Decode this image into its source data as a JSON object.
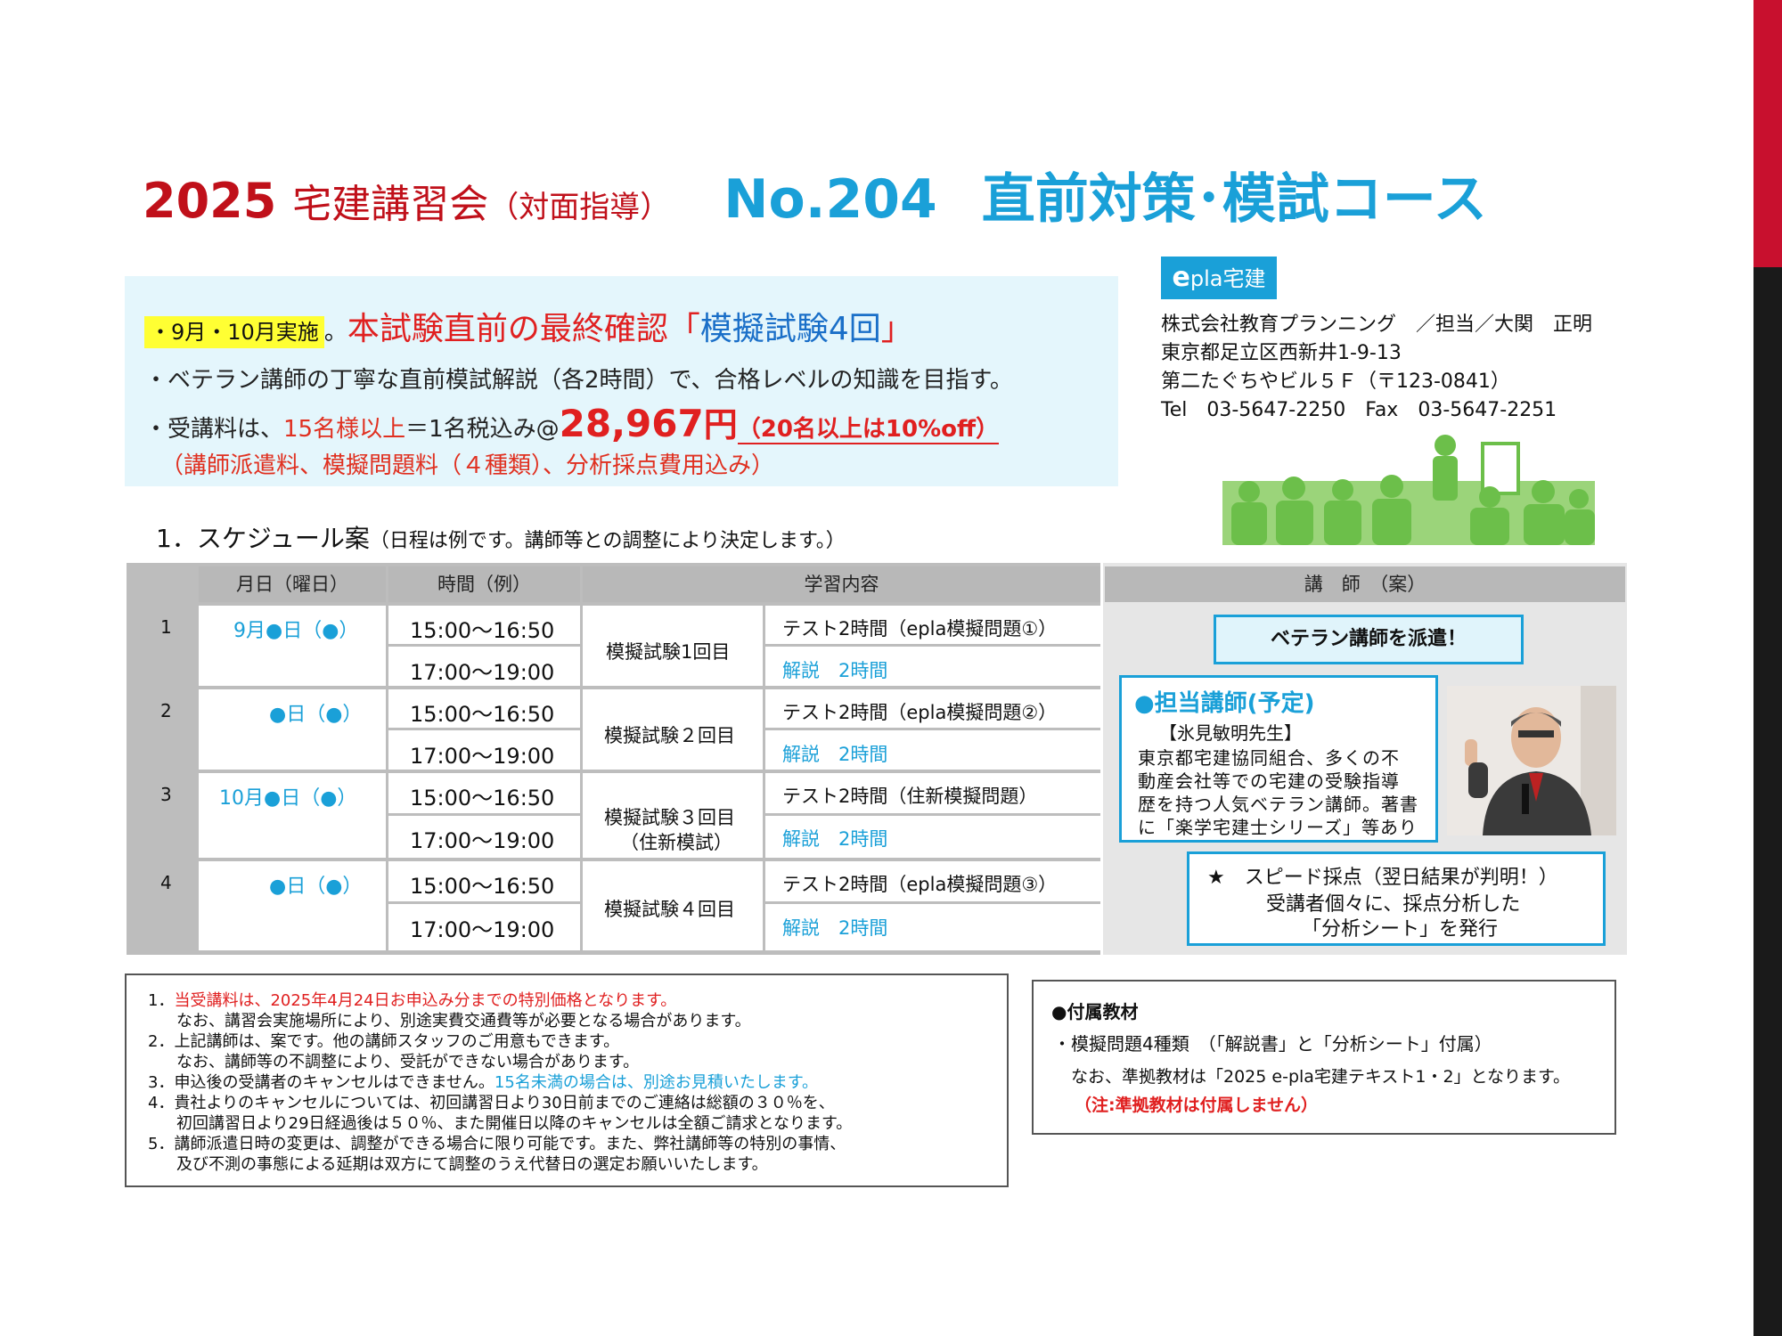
{
  "title": {
    "year": "2025",
    "main": "宅建講習会",
    "paren": "（対面指導）",
    "number": "No.204",
    "course": "直前対策･模試コース"
  },
  "intro": {
    "highlight": "・9月・10月実施",
    "line1_dot": "。",
    "line1_main": "本試験直前の最終確認",
    "line1_open": "「",
    "line1_blue": "模擬試験4回",
    "line1_close": "」",
    "line2": "・ベテラン講師の丁寧な直前模試解説（各2時間）で、合格レベルの知識を目指す。",
    "line3_pre": "・受講料は、",
    "line3_red1": "15名様以上",
    "line3_mid": "＝1名税込み@",
    "line3_amount": "28,967",
    "line3_yen": "円",
    "line3_note": "（20名以上は10%off）",
    "line4": "（講師派遣料、模擬問題料（４種類）、分析採点費用込み）"
  },
  "company": {
    "logo_e": "e",
    "logo_rest": "pla宅建",
    "name": "株式会社教育プランニング　／担当／大関　正明",
    "address": "東京都足立区西新井1-9-13",
    "building": "第二たぐちやビル５Ｆ（〒123-0841）",
    "tel": "Tel　03-5647-2250　Fax　03-5647-2251"
  },
  "schedule": {
    "heading": "1．スケジュール案",
    "subheading": "（日程は例です。講師等との調整により決定します。）",
    "headers": [
      "月日（曜日）",
      "時間（例）",
      "学習内容",
      "講　師　（案）"
    ],
    "rows": [
      {
        "num": "1",
        "date": "9月●日（●）",
        "time1": "15:00～16:50",
        "time2": "17:00～19:00",
        "exam": "模擬試験1回目",
        "exam2": "",
        "content1": "テスト2時間（epla模擬問題①）",
        "content2": "解説　2時間"
      },
      {
        "num": "2",
        "date": "●日（●）",
        "time1": "15:00～16:50",
        "time2": "17:00～19:00",
        "exam": "模擬試験２回目",
        "exam2": "",
        "content1": "テスト2時間（epla模擬問題②）",
        "content2": "解説　2時間"
      },
      {
        "num": "3",
        "date": "10月●日（●）",
        "time1": "15:00～16:50",
        "time2": "17:00～19:00",
        "exam": "模擬試験３回目",
        "exam2": "（住新模試）",
        "content1": "テスト2時間（住新模擬問題）",
        "content2": "解説　2時間"
      },
      {
        "num": "4",
        "date": "●日（●）",
        "time1": "15:00～16:50",
        "time2": "17:00～19:00",
        "exam": "模擬試験４回目",
        "exam2": "",
        "content1": "テスト2時間（epla模擬問題③）",
        "content2": "解説　2時間"
      }
    ]
  },
  "teacher": {
    "veteran": "ベテラン講師を派遣！",
    "heading": "●担当講師(予定)",
    "name": "【氷見敏明先生】",
    "desc": [
      "東京都宅建協同組合、多くの不",
      "動産会社等での宅建の受験指導",
      "歴を持つ人気ベテラン講師。著書",
      "に「楽学宅建士シリーズ」等あり"
    ],
    "speed": [
      "★　スピード採点（翌日結果が判明！）",
      "受講者個々に、採点分析した",
      "「分析シート」を発行"
    ]
  },
  "notes": {
    "n1_head": "1．",
    "n1_red": "当受講料は、2025年4月24日お申込み分までの特別価格となります。",
    "n1_b": "なお、講習会実施場所により、別途実費交通費等が必要となる場合があります。",
    "n2_a": "2．上記講師は、案です。他の講師スタッフのご用意もできます。",
    "n2_b": "なお、講師等の不調整により、受託ができない場合があります。",
    "n3_a": "3．申込後の受講者のキャンセルはできません。",
    "n3_cyan": "15名未満の場合は、別途お見積いたします。",
    "n4_a": "4．貴社よりのキャンセルについては、初回講習日より30日前までのご連絡は総額の３０％を、",
    "n4_b": "初回講習日より29日経過後は５０％、また開催日以降のキャンセルは全額ご請求となります。",
    "n5_a": "5．講師派遣日時の変更は、調整ができる場合に限り可能です。また、弊社講師等の特別の事情、",
    "n5_b": "及び不測の事態による延期は双方にて調整のうえ代替日の選定お願いいたします。"
  },
  "materials": {
    "heading": "●付属教材",
    "line1": "・模擬問題4種類　（「解説書」と「分析シート」付属）",
    "line2": "なお、準拠教材は「2025 e-pla宅建テキスト1・2」となります。",
    "line3": "（注:準拠教材は付属しません）"
  }
}
